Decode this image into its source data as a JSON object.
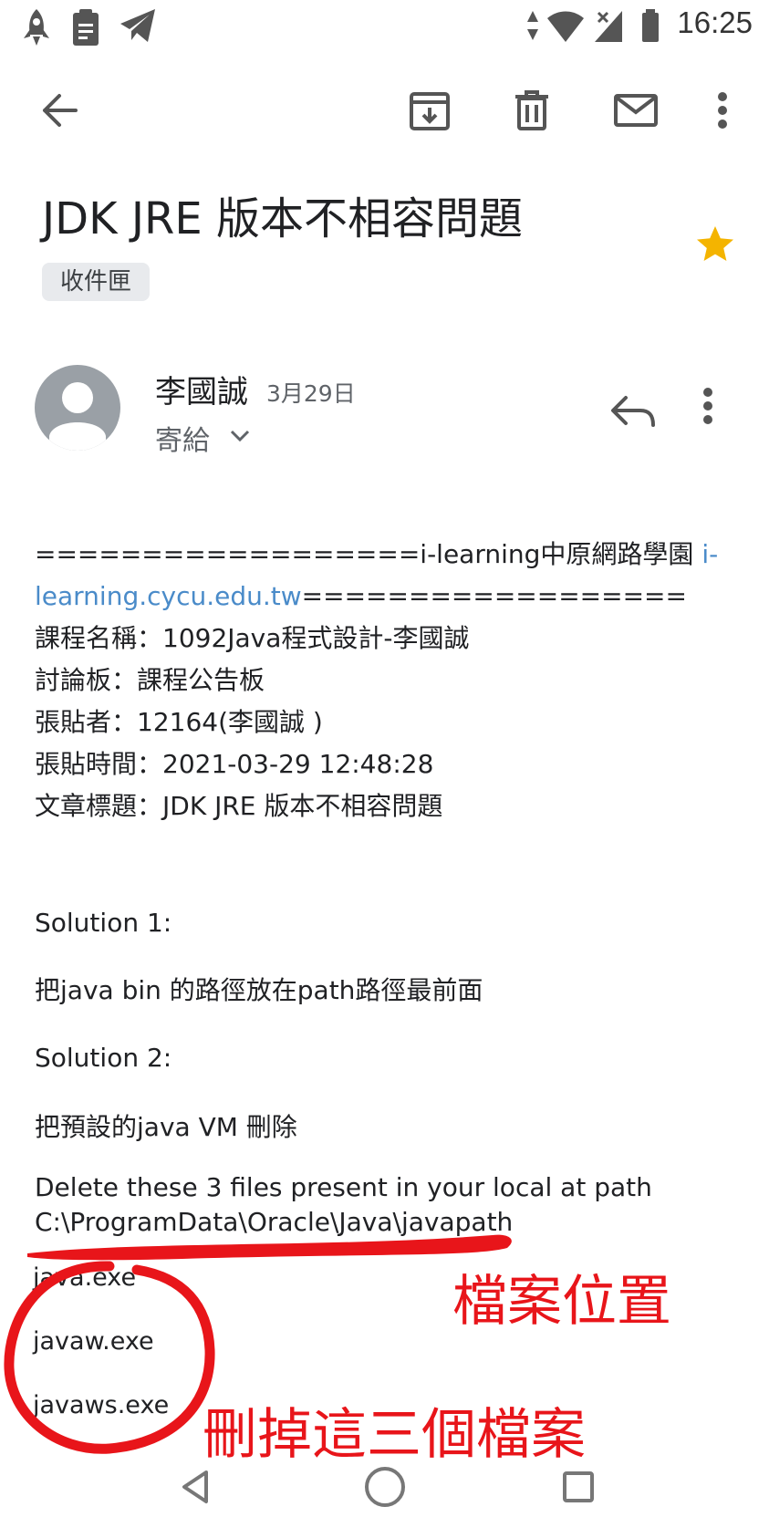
{
  "status_bar": {
    "time": "16:25",
    "icons": [
      "rocket-icon",
      "clipboard-icon",
      "telegram-icon",
      "data-arrows-icon",
      "wifi-icon",
      "signal-icon",
      "battery-icon"
    ]
  },
  "toolbar": {
    "icons": [
      "back-arrow-icon",
      "archive-icon",
      "trash-icon",
      "mail-icon",
      "more-vert-icon"
    ]
  },
  "email": {
    "subject": "JDK JRE 版本不相容問題",
    "label": "收件匣",
    "starred": true,
    "sender": "李國誠",
    "date": "3月29日",
    "recipient": "寄給"
  },
  "body": {
    "header_prefix": "==================i-learning中原網路學園 ",
    "header_link_part1": "i-",
    "header_link_part2": "learning.cycu.edu.tw",
    "header_suffix": "==================",
    "course": "課程名稱：1092Java程式設計-李國誠",
    "board": "討論板：課程公告板",
    "poster": "張貼者：12164(李國誠 )",
    "post_time": "張貼時間：2021-03-29 12:48:28",
    "post_title": "文章標題：JDK JRE 版本不相容問題",
    "solution1_heading": "Solution 1:",
    "solution1_text": "把java bin 的路徑放在path路徑最前面",
    "solution2_heading": "Solution 2:",
    "solution2_text": "把預設的java VM 刪除",
    "delete_instruction": "Delete these 3 files present in your local at path",
    "path": "C:\\ProgramData\\Oracle\\Java\\javapath",
    "files": [
      "java.exe",
      "javaw.exe",
      "javaws.exe"
    ]
  },
  "annotations": {
    "file_location": "檔案位置",
    "delete_three": "刪掉這三個檔案",
    "color": "#e8151a"
  },
  "nav_bar": {
    "icons": [
      "back-triangle-icon",
      "home-circle-icon",
      "recents-square-icon"
    ]
  }
}
